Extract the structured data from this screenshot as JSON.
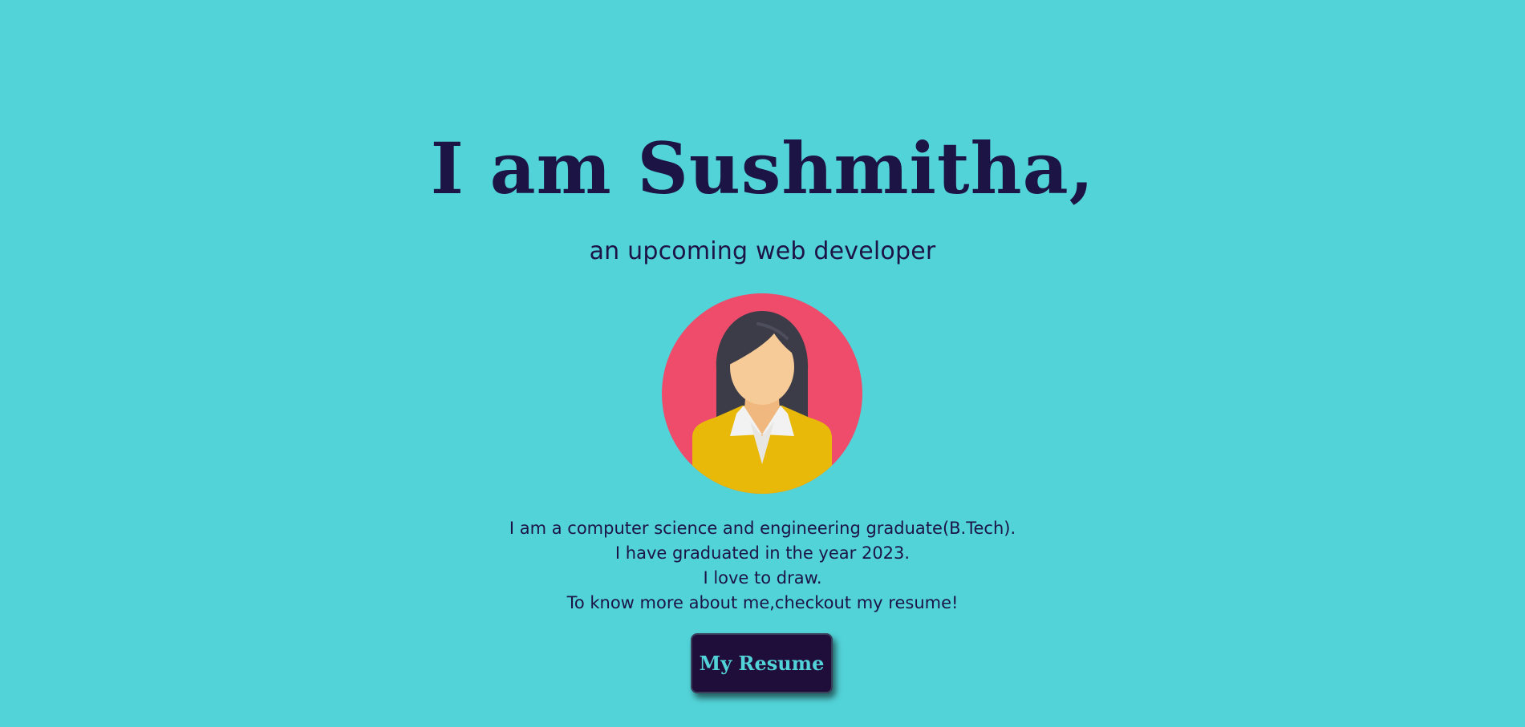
{
  "hero": {
    "headline": "I am Sushmitha,",
    "subtitle": "an upcoming web developer",
    "avatar_icon": "female-avatar-icon",
    "bio_lines": [
      "I am a computer science and engineering graduate(B.Tech).",
      "I have graduated in the year 2023.",
      "I love to draw.",
      "To know more about me,checkout my resume!"
    ],
    "resume_button_label": "My Resume"
  },
  "colors": {
    "background": "#52D3D8",
    "text": "#1C1445",
    "button_bg": "#200E3A",
    "button_text": "#52D3D8",
    "avatar_circle": "#EF4B6B",
    "avatar_shirt": "#E8B908",
    "avatar_hair": "#3B3C48",
    "avatar_skin": "#F7CB98"
  }
}
